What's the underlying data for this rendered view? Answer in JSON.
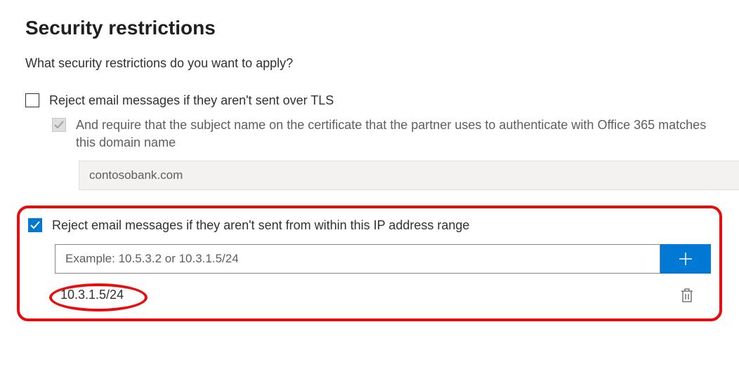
{
  "title": "Security restrictions",
  "intro": "What security restrictions do you want to apply?",
  "tls": {
    "checked": false,
    "label": "Reject email messages if they aren't sent over TLS",
    "cert": {
      "enabled": false,
      "label": "And require that the subject name on the certificate that the partner uses to authenticate with Office 365 matches this domain name",
      "domain": "contosobank.com"
    }
  },
  "ip": {
    "checked": true,
    "label": "Reject email messages if they aren't sent from within this IP address range",
    "input_placeholder": "Example: 10.5.3.2 or 10.3.1.5/24",
    "input_value": "",
    "entries": [
      "10.3.1.5/24"
    ]
  }
}
